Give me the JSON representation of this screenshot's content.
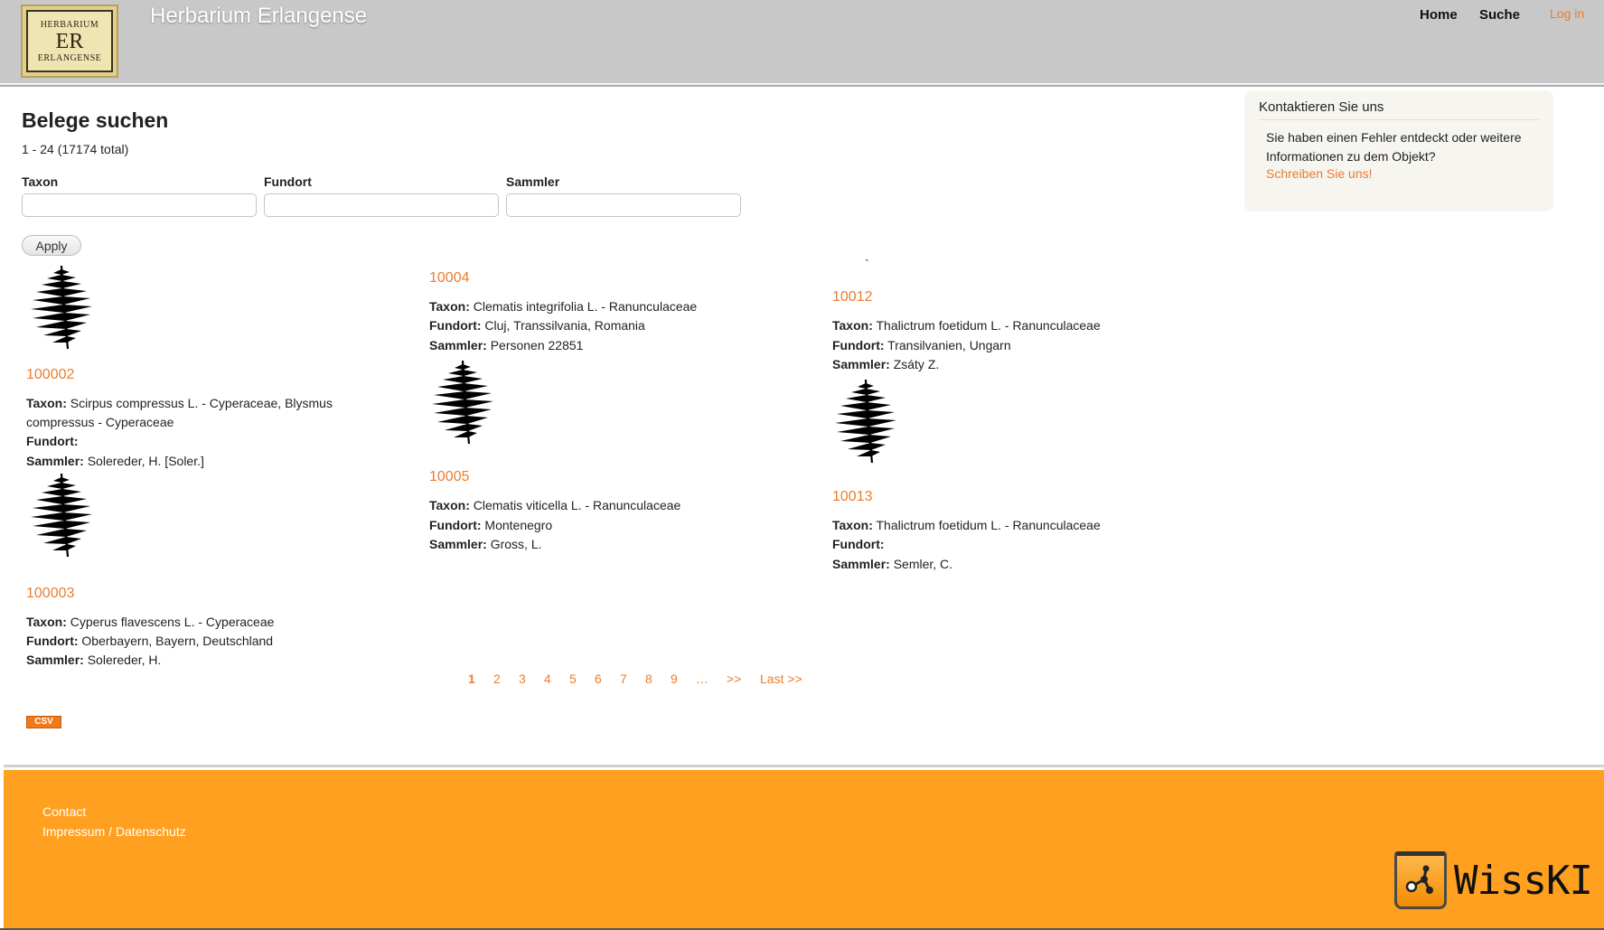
{
  "header": {
    "site_name": "Herbarium Erlangense",
    "logo": {
      "line1": "HERBARIUM",
      "line2": "ER",
      "line3": "ERLANGENSE"
    },
    "nav": [
      {
        "label": "Home"
      },
      {
        "label": "Suche"
      }
    ],
    "login_label": "Log in"
  },
  "main": {
    "title": "Belege suchen",
    "count": "1 - 24 (17174 total)",
    "filters": [
      {
        "label": "Taxon",
        "value": ""
      },
      {
        "label": "Fundort",
        "value": ""
      },
      {
        "label": "Sammler",
        "value": ""
      }
    ],
    "apply_label": "Apply",
    "field_labels": {
      "taxon": "Taxon:",
      "fundort": "Fundort:",
      "sammler": "Sammler:"
    },
    "records": [
      {
        "id": "100002",
        "taxon": "Scirpus compressus L. - Cyperaceae, Blysmus",
        "taxon_cont": "compressus - Cyperaceae",
        "fundort": "",
        "sammler": "Solereder, H. [Soler.]"
      },
      {
        "id": "100003",
        "taxon": "Cyperus flavescens L. - Cyperaceae",
        "fundort": "Oberbayern, Bayern, Deutschland",
        "sammler": "Solereder, H."
      },
      {
        "id": "10004",
        "taxon": "Clematis integrifolia L. - Ranunculaceae",
        "fundort": "Cluj, Transsilvania, Romania",
        "sammler": "Personen 22851"
      },
      {
        "id": "10005",
        "taxon": "Clematis viticella L. - Ranunculaceae",
        "fundort": "Montenegro",
        "sammler": "Gross, L."
      },
      {
        "id": "10012",
        "taxon": "Thalictrum foetidum L. - Ranunculaceae",
        "fundort": "Transilvanien, Ungarn",
        "sammler": "Zsáty Z."
      },
      {
        "id": "10013",
        "taxon": "Thalictrum foetidum L. - Ranunculaceae",
        "fundort": "",
        "sammler": "Semler, C."
      }
    ],
    "stray_mark": "`",
    "pager": {
      "current": "1",
      "pages": [
        "2",
        "3",
        "4",
        "5",
        "6",
        "7",
        "8",
        "9"
      ],
      "ellipsis": "…",
      "next": ">>",
      "last": "Last >>"
    },
    "csv_label": "CSV"
  },
  "sidebar": {
    "title": "Kontaktieren Sie uns",
    "text": "Sie haben einen Fehler entdeckt oder weitere Informationen zu dem Objekt?",
    "link": "Schreiben Sie uns!"
  },
  "footer": {
    "links": [
      "Contact",
      "Impressum / Datenschutz"
    ],
    "brand": "WissKI"
  },
  "colors": {
    "accent": "#ea7d2f",
    "header_bg": "#c8c8c8",
    "footer_bg": "#ffa020"
  }
}
